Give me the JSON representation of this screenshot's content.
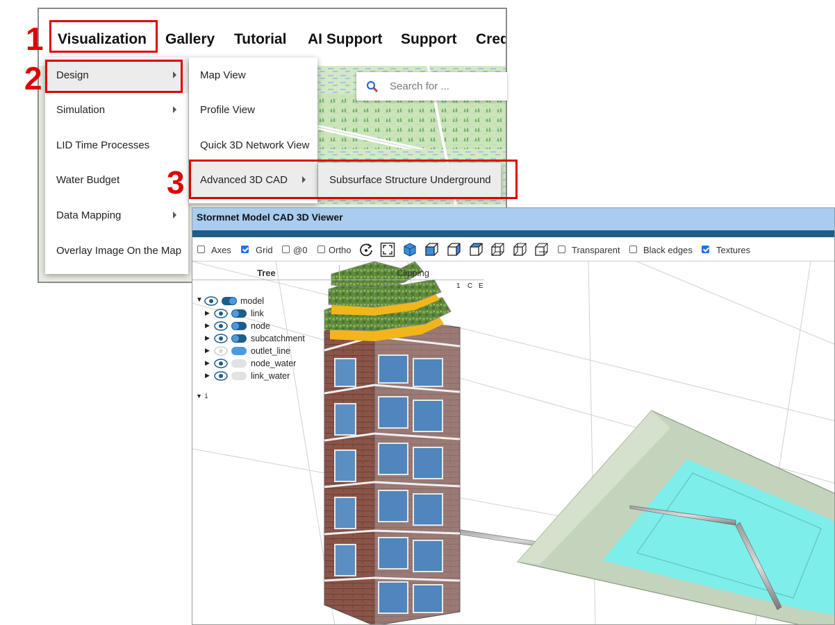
{
  "steps": [
    "1",
    "2",
    "3"
  ],
  "navbar": {
    "items": [
      "Visualization",
      "Gallery",
      "Tutorial",
      "AI Support",
      "Support",
      "Cred"
    ]
  },
  "visualization_menu": {
    "items": [
      {
        "label": "Design",
        "has_submenu": true
      },
      {
        "label": "Simulation",
        "has_submenu": true
      },
      {
        "label": "LID Time Processes",
        "has_submenu": false
      },
      {
        "label": "Water Budget",
        "has_submenu": false
      },
      {
        "label": "Data Mapping",
        "has_submenu": true
      },
      {
        "label": "Overlay Image On the Map",
        "has_submenu": false
      }
    ]
  },
  "design_submenu": {
    "items": [
      {
        "label": "Map View",
        "has_submenu": false
      },
      {
        "label": "Profile View",
        "has_submenu": false
      },
      {
        "label": "Quick 3D Network View",
        "has_submenu": false
      },
      {
        "label": "Advanced 3D CAD",
        "has_submenu": true
      }
    ]
  },
  "cad_submenu": {
    "items": [
      {
        "label": "Subsurface Structure Underground"
      }
    ]
  },
  "search": {
    "placeholder": "Search for ..."
  },
  "viewer": {
    "title": "Stormnet Model CAD 3D Viewer",
    "toolbar": {
      "axes": {
        "label": "Axes",
        "checked": false
      },
      "grid": {
        "label": "Grid",
        "checked": true
      },
      "at0": {
        "label": "@0",
        "checked": false
      },
      "ortho": {
        "label": "Ortho",
        "checked": false
      },
      "transparent": {
        "label": "Transparent",
        "checked": false
      },
      "black_edges": {
        "label": "Black edges",
        "checked": false
      },
      "textures": {
        "label": "Textures",
        "checked": true
      }
    },
    "tabs": [
      "Tree",
      "Clipping"
    ],
    "tree_header": [
      "1",
      "C",
      "E"
    ],
    "tree": {
      "root": "model",
      "children": [
        "link",
        "node",
        "subcatchment",
        "outlet_line",
        "node_water",
        "link_water"
      ],
      "footer": "i"
    }
  },
  "colors": {
    "highlight": "#e00000",
    "viewer_title_bg": "#a9cdf0",
    "viewer_band": "#1f5c86",
    "checkbox_on": "#1e73e8",
    "water": "#7eeeea",
    "pond_rim": "#c4d3bb"
  }
}
